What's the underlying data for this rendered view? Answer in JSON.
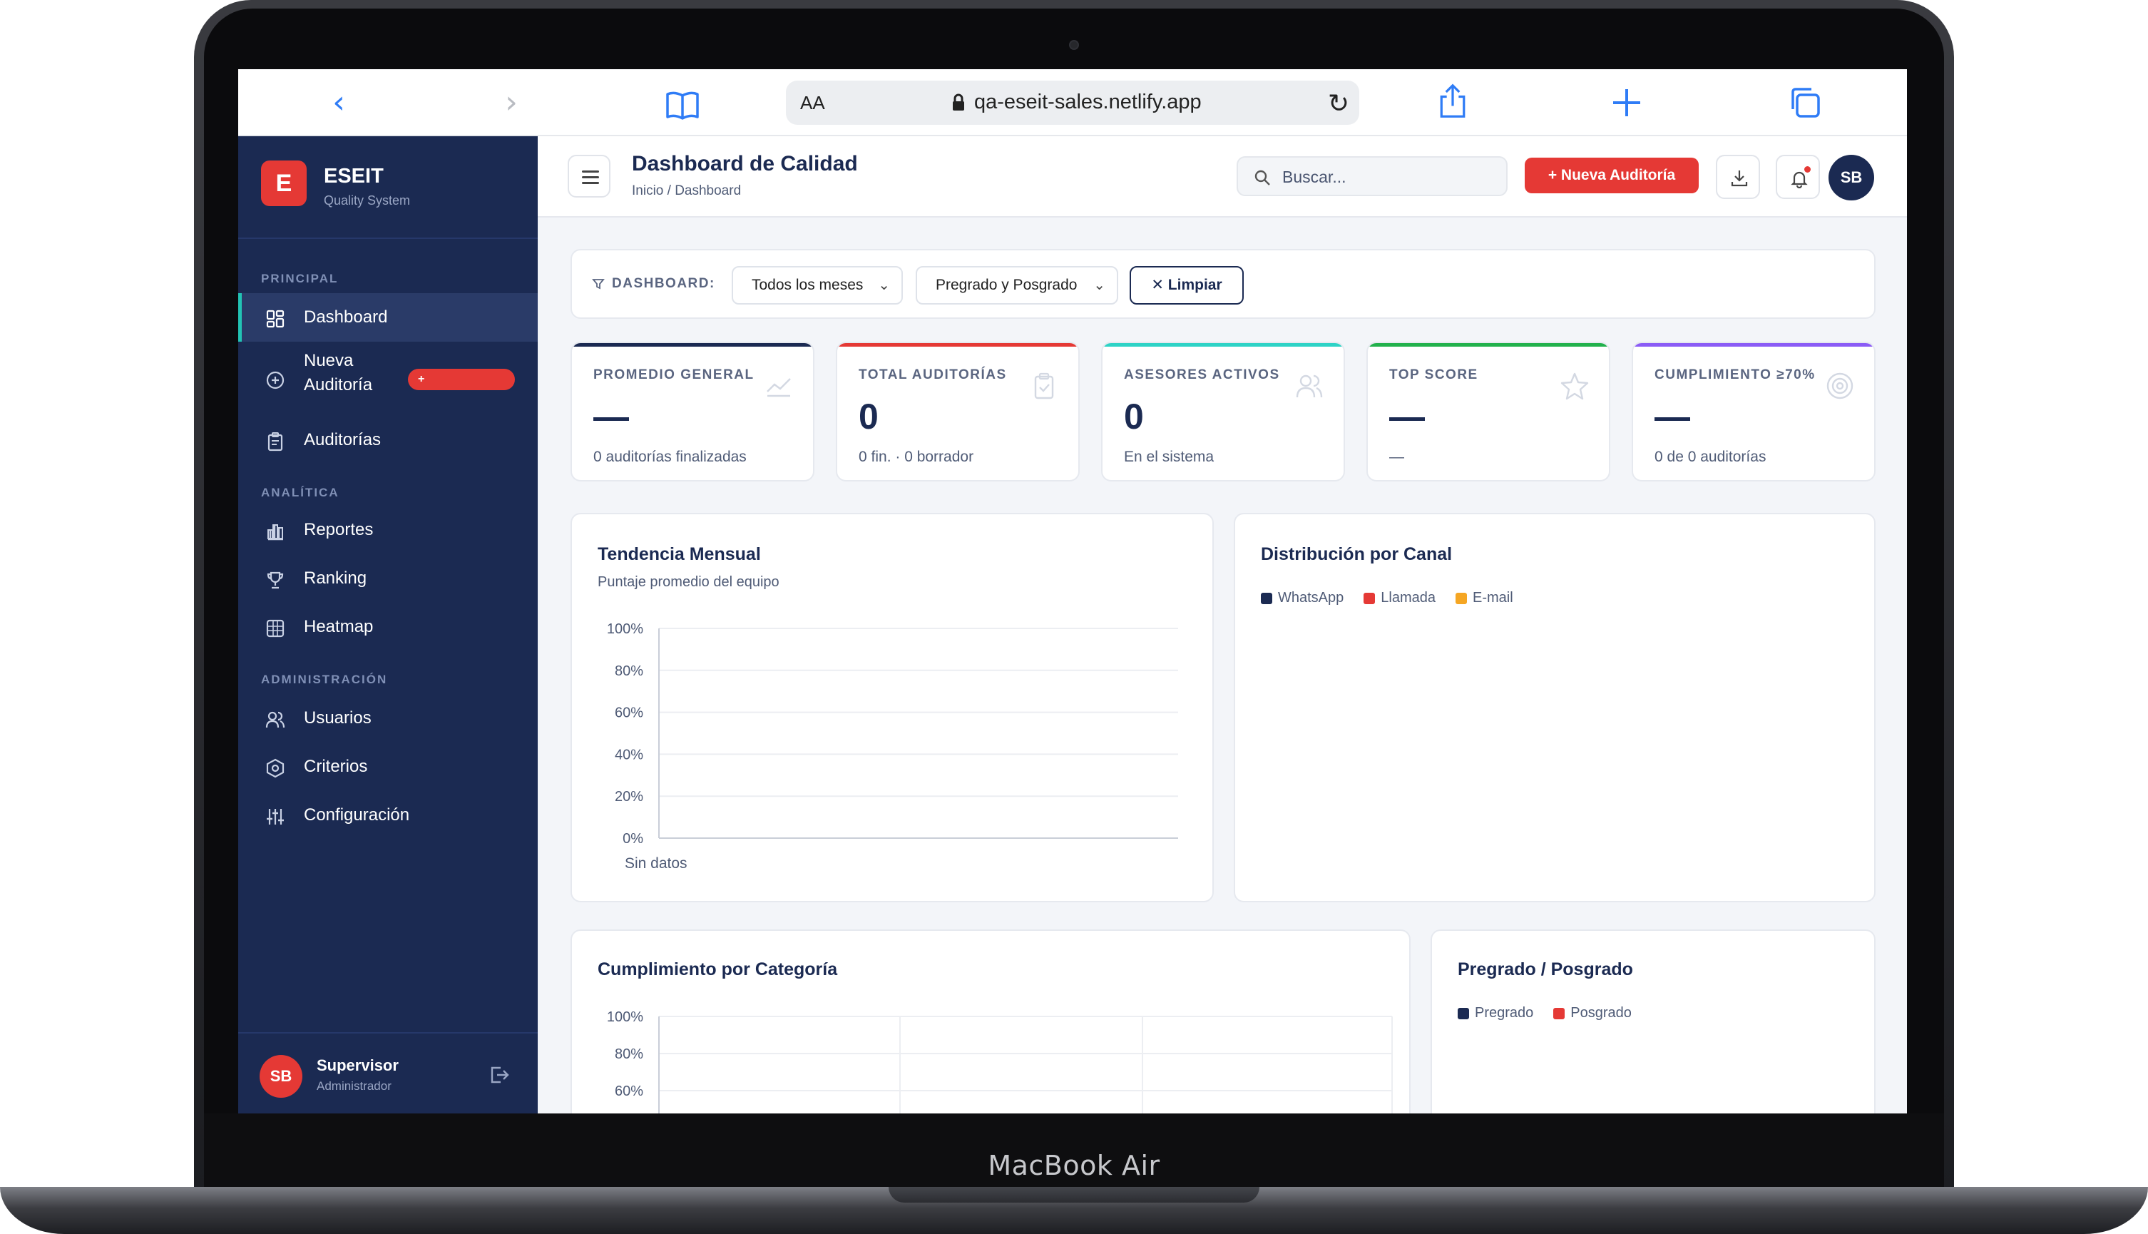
{
  "device": {
    "label": "MacBook Air"
  },
  "browser": {
    "aa": "AA",
    "url": "qa-eseit-sales.netlify.app"
  },
  "sidebar": {
    "logo_letter": "E",
    "brand": "ESEIT",
    "brand_sub": "Quality System",
    "sections": {
      "principal": "PRINCIPAL",
      "analitica": "ANALÍTICA",
      "admin": "ADMINISTRACIÓN"
    },
    "items": [
      {
        "label": "Dashboard",
        "icon": "dashboard-grid-icon",
        "active": true
      },
      {
        "label": "Nueva Auditoría",
        "icon": "plus-circle-icon",
        "badge": "+"
      },
      {
        "label": "Auditorías",
        "icon": "clipboard-icon"
      },
      {
        "label": "Reportes",
        "icon": "bar-chart-icon"
      },
      {
        "label": "Ranking",
        "icon": "trophy-icon"
      },
      {
        "label": "Heatmap",
        "icon": "heatmap-icon"
      },
      {
        "label": "Usuarios",
        "icon": "users-icon"
      },
      {
        "label": "Criterios",
        "icon": "hexagon-icon"
      },
      {
        "label": "Configuración",
        "icon": "sliders-icon"
      }
    ],
    "user": {
      "initials": "SB",
      "name": "Supervisor",
      "role": "Administrador"
    }
  },
  "topbar": {
    "title": "Dashboard de Calidad",
    "breadcrumb": "Inicio / Dashboard",
    "search_placeholder": "Buscar...",
    "new_audit": "+  Nueva Auditoría",
    "avatar": "SB"
  },
  "filters": {
    "label": "DASHBOARD:",
    "month": "Todos los meses",
    "level": "Pregrado y Posgrado",
    "clear": "Limpiar"
  },
  "kpis": [
    {
      "title": "PROMEDIO GENERAL",
      "value": "—",
      "sub": "0 auditorías finalizadas",
      "color": "#1b2a52"
    },
    {
      "title": "TOTAL AUDITORÍAS",
      "value": "0",
      "sub": "0 fin. · 0 borrador",
      "color": "#e53935"
    },
    {
      "title": "ASESORES ACTIVOS",
      "value": "0",
      "sub": "En el sistema",
      "color": "#2ed3c6"
    },
    {
      "title": "TOP SCORE",
      "value": "—",
      "sub": "—",
      "color": "#22b14c"
    },
    {
      "title": "CUMPLIMIENTO ≥70%",
      "value": "—",
      "sub": "0 de 0 auditorías",
      "color": "#8b5cf6"
    }
  ],
  "charts": {
    "trend": {
      "title": "Tendencia Mensual",
      "subtitle": "Puntaje promedio del equipo",
      "empty": "Sin datos"
    },
    "channel": {
      "title": "Distribución por Canal"
    },
    "category": {
      "title": "Cumplimiento por Categoría"
    },
    "level": {
      "title": "Pregrado / Posgrado"
    }
  },
  "chart_data": [
    {
      "type": "line",
      "title": "Tendencia Mensual",
      "subtitle": "Puntaje promedio del equipo",
      "ylim": [
        0,
        100
      ],
      "yticks": [
        "100%",
        "80%",
        "60%",
        "40%",
        "20%",
        "0%"
      ],
      "categories": [
        "Sin datos"
      ],
      "series": [],
      "grid": true
    },
    {
      "type": "pie",
      "title": "Distribución por Canal",
      "legend": [
        "WhatsApp",
        "Llamada",
        "E-mail"
      ],
      "legend_colors": [
        "#1b2a52",
        "#e53935",
        "#f5a623"
      ],
      "values": []
    },
    {
      "type": "bar",
      "title": "Cumplimiento por Categoría",
      "ylim": [
        0,
        100
      ],
      "yticks": [
        "100%",
        "80%",
        "60%"
      ],
      "categories": [],
      "values": [],
      "grid": true
    },
    {
      "type": "pie",
      "title": "Pregrado / Posgrado",
      "legend": [
        "Pregrado",
        "Posgrado"
      ],
      "legend_colors": [
        "#1b2a52",
        "#e53935"
      ],
      "values": []
    }
  ]
}
